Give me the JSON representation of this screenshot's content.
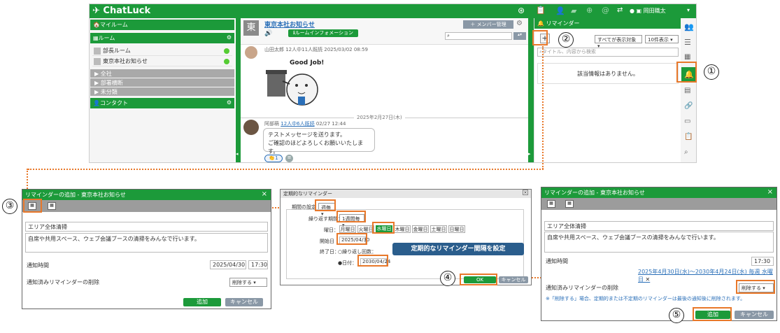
{
  "app": {
    "name": "ChatLuck",
    "user": "岡田職太"
  },
  "sidebar": {
    "my_room": "マイルーム",
    "rooms_header": "ルーム",
    "rooms": [
      {
        "label": "部長ルーム"
      },
      {
        "label": "東京本社お知らせ"
      }
    ],
    "groups": [
      "全社",
      "部署横断",
      "未分類"
    ],
    "contacts": "コンタクト"
  },
  "chat": {
    "room_title": "東京本社お知らせ",
    "room_avatar": "東",
    "room_info_btn": "ルームインフォメーション",
    "member_btn": "メンバー管理",
    "msg1_meta": "山田太郎 12人中11人既読 2025/03/02 08:59",
    "sticker_text": "Good Job!!",
    "date_divider": "2025年2月27日(木)",
    "msg2_sender": "阿部萌",
    "msg2_read": "12人中6人既読",
    "msg2_time": "02/27 12:44",
    "msg2_line1": "テストメッセージを送ります。",
    "msg2_line2": "ご確認のほどよろしくお願いいたします。",
    "reaction_count": "1"
  },
  "reminder_panel": {
    "title": "リマインダー",
    "filter": "すべてが表示対象",
    "per_page": "10件表示",
    "search_placeholder": "タイトル、内容から検索",
    "empty": "該当情報はありません。"
  },
  "dialog_add": {
    "title": "リマインダーの追加 - 東京本社お知らせ",
    "subject": "エリア全体清掃",
    "body": "自席や共用スペース、ウェブ会議ブースの清掃をみんなで行います。",
    "notify_label": "通知時間",
    "date": "2025/04/30",
    "time": "17:30",
    "delete_label": "通知済みリマインダーの削除",
    "delete_value": "削除する",
    "add_btn": "追加",
    "cancel_btn": "キャンセル"
  },
  "dialog_periodic": {
    "title": "定期的なリマインダー",
    "period_label": "期間の設定",
    "period_value": "週毎",
    "repeat_label": "繰り返す期間：",
    "repeat_value": "1週間毎",
    "weekday_label": "曜日：",
    "weekdays": [
      "月曜日",
      "火曜日",
      "水曜日",
      "木曜日",
      "金曜日",
      "土曜日",
      "日曜日"
    ],
    "selected_weekday": "水曜日",
    "start_label": "開始日",
    "start_date": "2025/04/30",
    "end_label": "終了日：",
    "end_opt1": "繰り返し回数：",
    "end_opt2": "日付：",
    "end_date": "2030/04/24",
    "ok_btn": "OK",
    "cancel_btn": "キャンセル",
    "callout": "定期的なリマインダー間隔を設定"
  },
  "dialog_result": {
    "title": "リマインダーの追加 - 東京本社お知らせ",
    "subject": "エリア全体清掃",
    "body": "自席や共用スペース、ウェブ会議ブースの清掃をみんなで行います。",
    "notify_label": "通知時間",
    "time": "17:30",
    "period_text": "2025年4月30日(水)～2030年4月24日(水) 毎週 水曜日",
    "delete_label": "通知済みリマインダーの削除",
    "delete_value": "削除する",
    "note": "※「削除する」場合、定期的または不定期のリマインダーは最後の通知後に削除されます。",
    "add_btn": "追加",
    "cancel_btn": "キャンセル"
  },
  "steps": [
    "①",
    "②",
    "③",
    "④",
    "⑤"
  ],
  "colors": {
    "brand": "#1c9a3a",
    "highlight": "#e8782a",
    "link": "#2a6fb8",
    "callout": "#2a5d8c"
  }
}
